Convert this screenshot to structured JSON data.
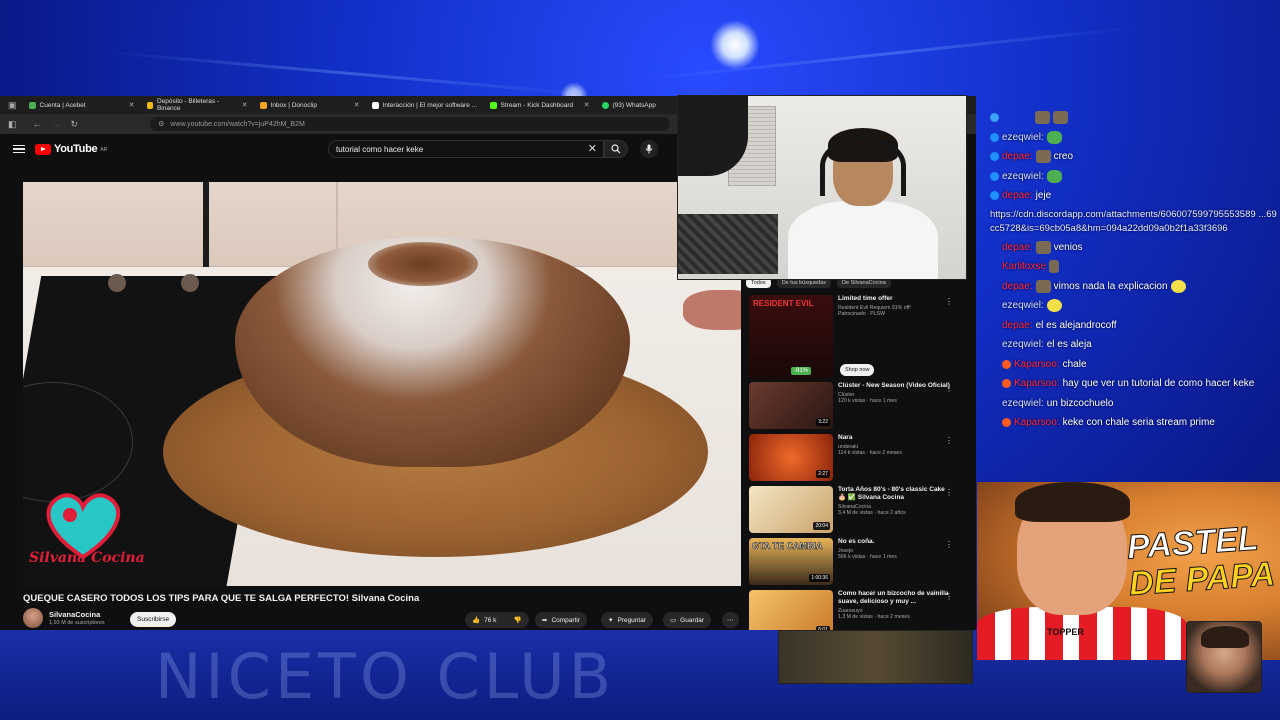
{
  "browser": {
    "tabs": [
      {
        "label": "Cuenta | Acebet",
        "color": "#4caf50"
      },
      {
        "label": "Depósito - Billeteras - Binance",
        "color": "#f0b90b"
      },
      {
        "label": "Inbox | Donoclip",
        "color": "#f5a623"
      },
      {
        "label": "Interacción | El mejor software ...",
        "color": "#ffffff"
      },
      {
        "label": "Stream - Kick Dashboard",
        "color": "#53fc18"
      },
      {
        "label": "(93) WhatsApp",
        "color": "#25d366"
      }
    ],
    "url": "www.youtube.com/watch?v=juP42hM_B2M"
  },
  "youtube": {
    "logo_text": "YouTube",
    "logo_country": "AR",
    "search_query": "tutorial como hacer keke",
    "video": {
      "title": "QUEQUE CASERO TODOS LOS TIPS PARA QUE TE SALGA PERFECTO! Silvana Cocina",
      "watermark": "Silvana Cocina",
      "channel": "SilvanaCocina",
      "subscribers": "1,93 M de suscriptores",
      "subscribe_label": "Suscribirse",
      "likes": "76 k",
      "share_label": "Compartir",
      "ask_label": "Preguntar",
      "save_label": "Guardar"
    },
    "chips": [
      "Todos",
      "De tus búsquedas",
      "De SilvanaCocina"
    ],
    "recommendations": [
      {
        "title": "Limited time offer",
        "line2": "Resident Evil Requiem 91% off!",
        "line3": "Patrocinado · PLSW",
        "badge": "-91%",
        "extra": "Shop now",
        "thumb_color": "#3a0d0d",
        "thumb_text": "RESIDENT EVIL"
      },
      {
        "title": "Clúster - New Season (Video Oficial)",
        "line2": "Clúster",
        "line3": "120 k vistas · hace 1 mes",
        "duration": "3:22",
        "thumb_color": "#4a2a22",
        "thumb_text": ""
      },
      {
        "title": "Nara",
        "line2": "underaki",
        "line3": "114 k vistas · hace 2 meses",
        "duration": "2:27",
        "thumb_color": "#b33a12",
        "thumb_text": ""
      },
      {
        "title": "Torta Años 80's - 80's classic Cake 🎂 ✅ Silvana Cocina",
        "line2": "SilvanaCocina",
        "line3": "3,4 M de vistas · hace 2 años",
        "duration": "20:04",
        "thumb_color": "#e6d2a8",
        "thumb_text": ""
      },
      {
        "title": "No es coña.",
        "line2": "Josejo",
        "line3": "566 k vistas · hace 1 mes",
        "duration": "1:00:36",
        "thumb_color": "#8a6a3a",
        "thumb_text": "GTA TE CAMBIA"
      },
      {
        "title": "Como hacer un bizcocho de vainilla suave, delicioso y muy ...",
        "line2": "Zuarosuyo",
        "line3": "1,3 M de vistas · hace 2 meses",
        "duration": "6:01",
        "thumb_color": "#e9a03a",
        "thumb_text": ""
      }
    ]
  },
  "chat": {
    "messages": [
      {
        "user": "",
        "text": "",
        "emote": "emote",
        "user_color": "white"
      },
      {
        "user": "ezeqwiel:",
        "text": "",
        "emote": "frog",
        "user_color": "white"
      },
      {
        "user": "depae:",
        "text": "creo",
        "emote": "emote",
        "user_color": "red"
      },
      {
        "user": "ezeqwiel:",
        "text": "",
        "emote": "frog",
        "user_color": "white"
      },
      {
        "user": "depae:",
        "text": "jeje",
        "emote": "",
        "user_color": "red"
      },
      {
        "user": "",
        "text": "https://cdn.discordapp.com/attachments/606007599795553589 ...69cc5728&is=69cb05a8&hm=094a22dd09a0b2f1a33f3696",
        "emote": "",
        "user_color": "white"
      },
      {
        "user": "depae:",
        "text": "venios",
        "emote": "emote",
        "user_color": "red"
      },
      {
        "user": "Karlitoxse",
        "text": "",
        "emote": "",
        "user_color": "red"
      },
      {
        "user": "depae:",
        "text": "vimos nada la explicacion",
        "emote": "emote",
        "user_color": "red"
      },
      {
        "user": "ezeqwiel:",
        "text": "",
        "emote": "lemon",
        "user_color": "white"
      },
      {
        "user": "depae:",
        "text": "el es alejandrocoff",
        "emote": "",
        "user_color": "red"
      },
      {
        "user": "ezeqwiel:",
        "text": "el es aleja",
        "emote": "",
        "user_color": "white"
      },
      {
        "user": "Kaparsoo:",
        "text": "chale",
        "emote": "",
        "user_color": "red"
      },
      {
        "user": "Kaparsoo:",
        "text": "hay que ver un tutorial de como hacer keke",
        "emote": "",
        "user_color": "red"
      },
      {
        "user": "ezeqwiel:",
        "text": "un bizcochuelo",
        "emote": "",
        "user_color": "white"
      },
      {
        "user": "Kaparsoo:",
        "text": "keke con chale seria stream prime",
        "emote": "",
        "user_color": "red"
      }
    ]
  },
  "overlay": {
    "pastel_line1": "PASTEL",
    "pastel_line2": "DE PAPA",
    "shirt_text": "TOPPER",
    "bottom_text": "NICETO CLUB"
  }
}
